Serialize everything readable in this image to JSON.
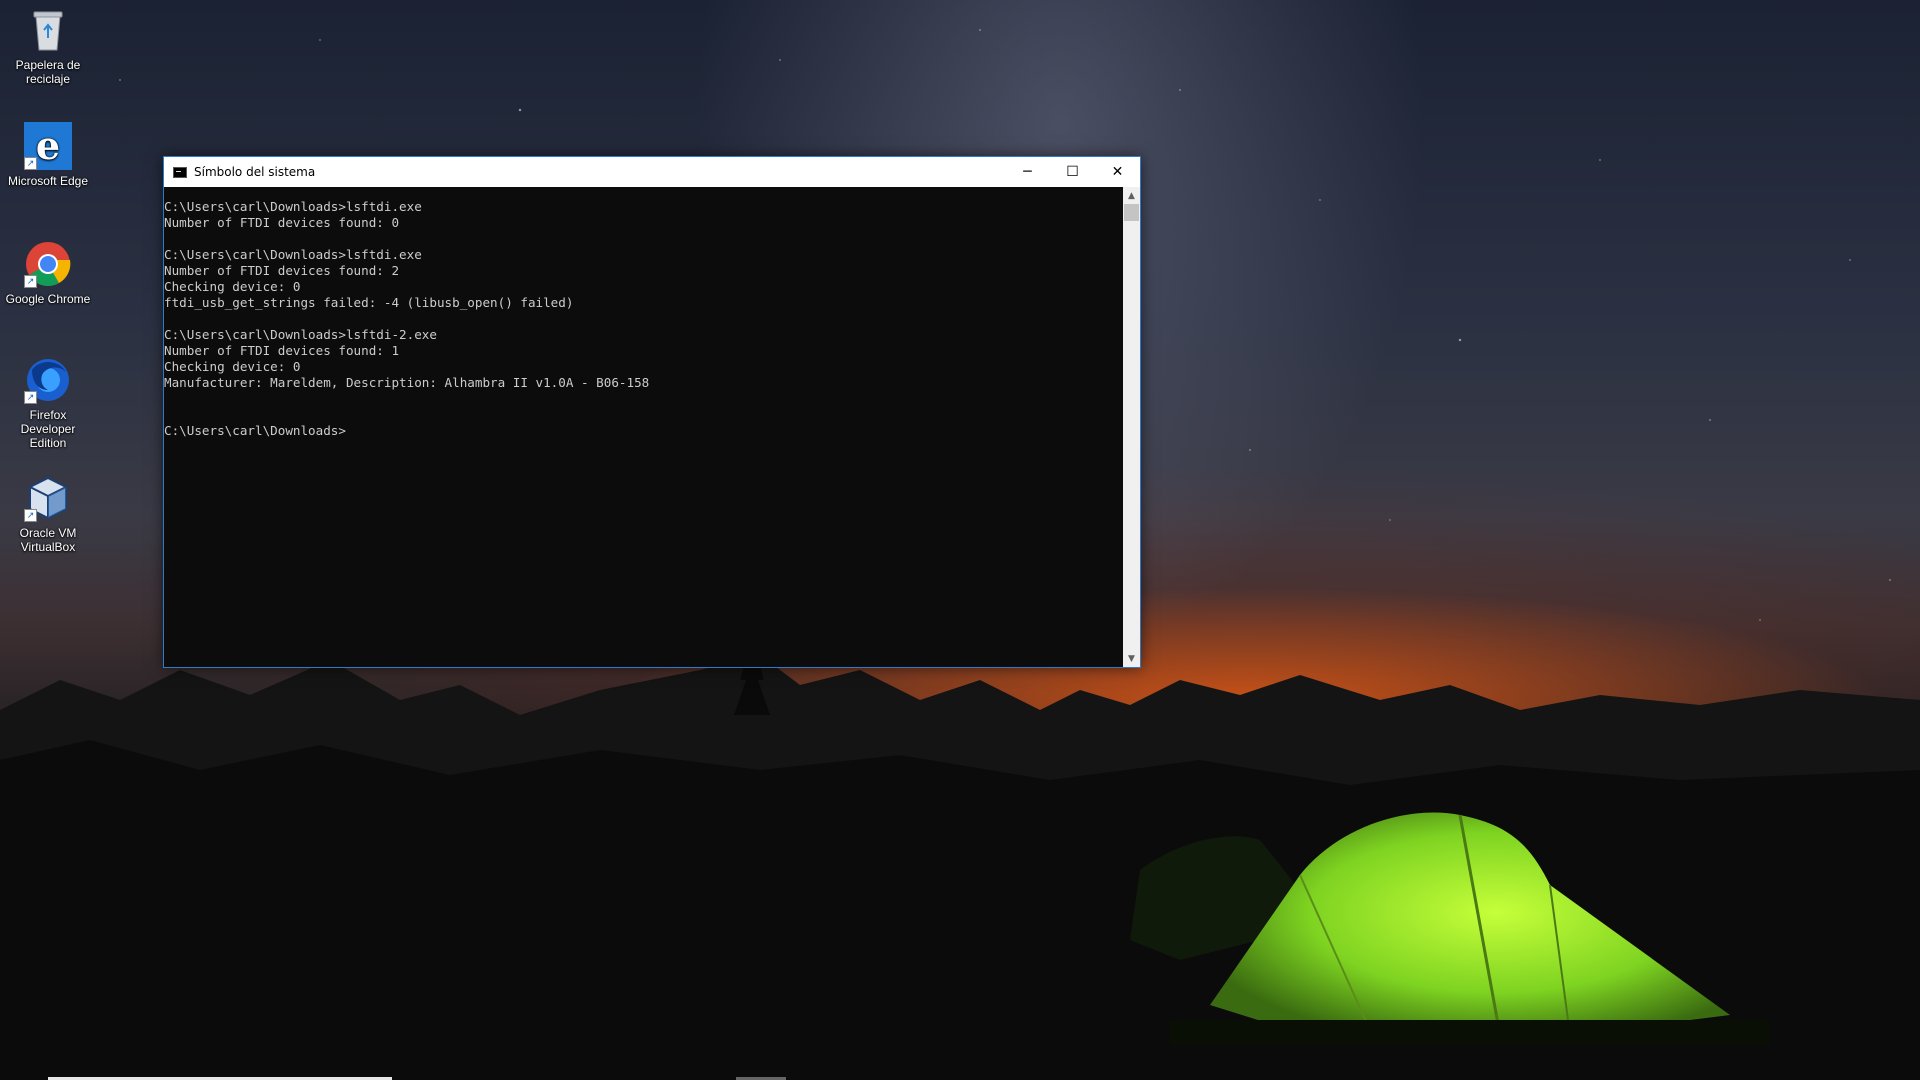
{
  "desktop": {
    "icons": [
      {
        "label": "Papelera de reciclaje",
        "icon": "recycle-bin-icon"
      },
      {
        "label": "Microsoft Edge",
        "icon": "edge-icon"
      },
      {
        "label": "Google Chrome",
        "icon": "chrome-icon"
      },
      {
        "label": "Firefox Developer Edition",
        "icon": "firefox-icon"
      },
      {
        "label": "Oracle VM VirtualBox",
        "icon": "virtualbox-icon"
      }
    ]
  },
  "window": {
    "title": "Símbolo del sistema",
    "minimize_glyph": "─",
    "maximize_glyph": "☐",
    "close_glyph": "✕",
    "console_lines": [
      "C:\\Users\\carl\\Downloads>lsftdi.exe",
      "Number of FTDI devices found: 0",
      "",
      "C:\\Users\\carl\\Downloads>lsftdi.exe",
      "Number of FTDI devices found: 2",
      "Checking device: 0",
      "ftdi_usb_get_strings failed: -4 (libusb_open() failed)",
      "",
      "C:\\Users\\carl\\Downloads>lsftdi-2.exe",
      "Number of FTDI devices found: 1",
      "Checking device: 0",
      "Manufacturer: Mareldem, Description: Alhambra II v1.0A - B06-158",
      "",
      "",
      "C:\\Users\\carl\\Downloads>"
    ]
  },
  "colors": {
    "console_bg": "#0c0c0c",
    "console_fg": "#cccccc",
    "window_border": "#2f79c8",
    "titlebar_bg": "#ffffff"
  }
}
